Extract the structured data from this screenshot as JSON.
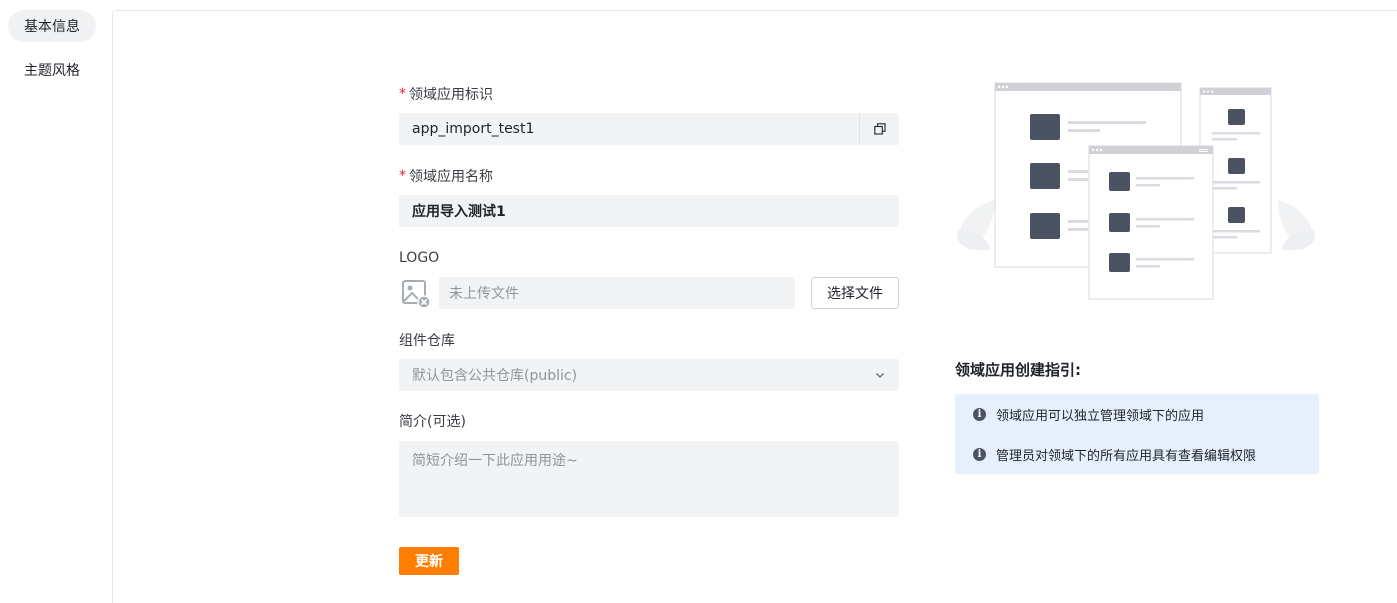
{
  "sidebar": {
    "items": [
      {
        "label": "基本信息",
        "active": true
      },
      {
        "label": "主题风格",
        "active": false
      }
    ]
  },
  "form": {
    "app_id": {
      "label": "领域应用标识",
      "required": true,
      "value": "app_import_test1"
    },
    "app_name": {
      "label": "领域应用名称",
      "required": true,
      "value": "应用导入测试1"
    },
    "logo": {
      "label": "LOGO",
      "placeholder": "未上传文件",
      "button_label": "选择文件"
    },
    "repo": {
      "label": "组件仓库",
      "selected": "默认包含公共仓库(public)"
    },
    "intro": {
      "label": "简介(可选)",
      "placeholder": "简短介绍一下此应用用途~"
    },
    "submit_label": "更新"
  },
  "guide": {
    "title": "领域应用创建指引:",
    "items": [
      "领域应用可以独立管理领域下的应用",
      "管理员对领域下的所有应用具有查看编辑权限"
    ]
  },
  "colors": {
    "accent": "#ff7d00",
    "required": "#f5222d",
    "field_bg": "#f2f3f5",
    "guide_bg": "#e6f0fc",
    "illus_block": "#4b5261"
  },
  "icons": {
    "copy": "copy-icon",
    "logo": "image-placeholder-icon",
    "chevron": "chevron-down-icon",
    "info": "info-icon"
  }
}
